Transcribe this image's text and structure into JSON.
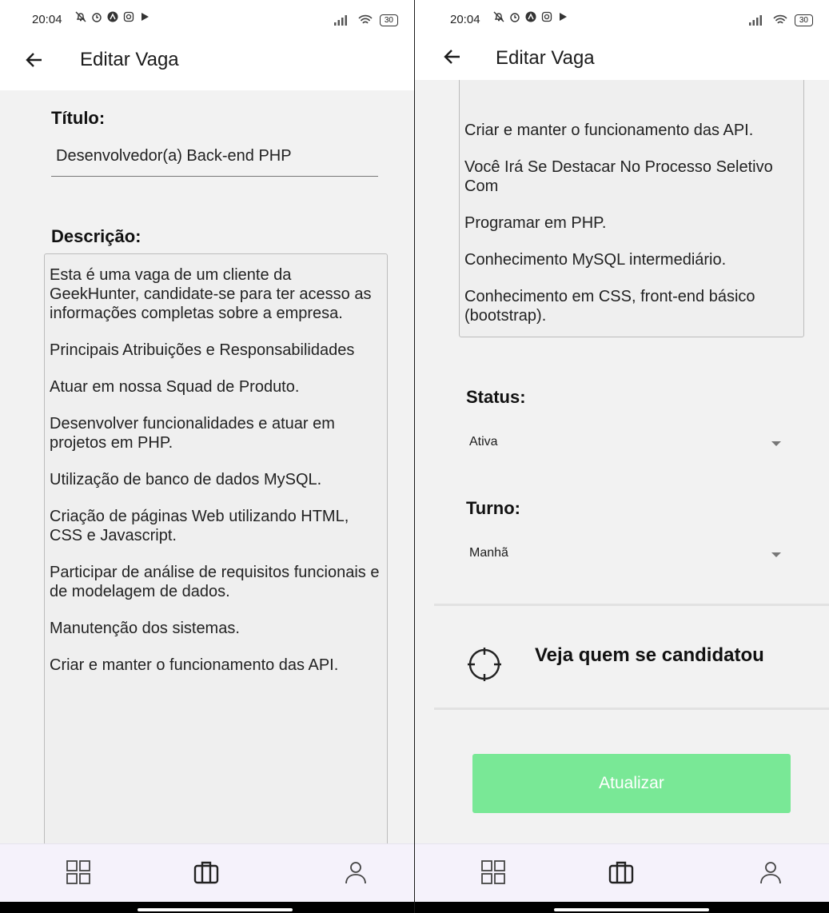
{
  "colors": {
    "accent_button": "#79e896",
    "background": "#f2f2f2",
    "nav_background": "#f5f2fb"
  },
  "status_bar": {
    "time": "20:04",
    "battery": "30",
    "icons": [
      "mute-icon",
      "alarm-icon",
      "app-icon",
      "instagram-icon",
      "play-icon",
      "signal-icon",
      "wifi-icon",
      "battery-icon"
    ]
  },
  "appbar": {
    "title": "Editar Vaga"
  },
  "form": {
    "title_label": "Título:",
    "title_value": "Desenvolvedor(a) Back-end PHP",
    "description_label": "Descrição:",
    "description_paragraphs": [
      "Esta é uma vaga de um cliente da GeekHunter, candidate-se para ter acesso as informações completas sobre a empresa.",
      "Principais Atribuições e Responsabilidades",
      "Atuar em nossa Squad de Produto.",
      "Desenvolver funcionalidades e atuar em projetos em PHP.",
      "Utilização de banco de dados MySQL.",
      "Criação de páginas Web utilizando HTML, CSS e Javascript.",
      "Participar de análise de requisitos funcionais e de modelagem de dados.",
      "Manutenção dos sistemas.",
      "Criar e manter o funcionamento das API.",
      "Você Irá Se Destacar No Processo Seletivo Com",
      "Programar em PHP.",
      "Conhecimento MySQL intermediário.",
      "Conhecimento em CSS, front-end básico (bootstrap)."
    ],
    "status_label": "Status:",
    "status_value": "Ativa",
    "shift_label": "Turno:",
    "shift_value": "Manhã",
    "candidates_label": "Veja quem se candidatou",
    "update_button": "Atualizar"
  },
  "bottom_nav": {
    "items": [
      "dashboard-icon",
      "briefcase-icon",
      "person-icon"
    ],
    "selected": "briefcase-icon"
  }
}
